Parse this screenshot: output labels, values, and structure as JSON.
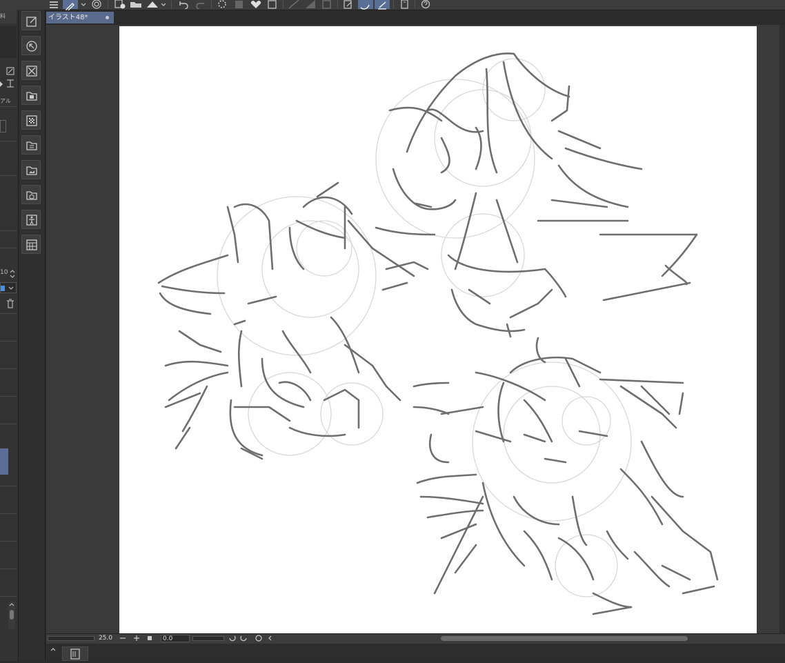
{
  "document": {
    "tab_title": "イラスト48*"
  },
  "left_panel": {
    "text_top": "料",
    "text_mid": "アル",
    "number": "10"
  },
  "bottom_bar": {
    "zoom_value": "25.0",
    "rotation_value": "0.0"
  },
  "icons": {
    "toolbar": [
      "menu-icon",
      "pen-settings-icon",
      "chevron-down-icon",
      "spiral-icon",
      "new-icon",
      "open-folder-icon",
      "save-icon",
      "undo-icon",
      "redo-icon",
      "loading-icon",
      "fill-icon",
      "heart-icon",
      "crop-icon",
      "slash-icon",
      "gradient-icon",
      "frame-icon",
      "edit-icon",
      "stabilizer-icon",
      "transform-icon",
      "phone-icon",
      "help-icon"
    ],
    "column": [
      "canvas-properties-icon",
      "select-arrow-icon",
      "deselect-icon",
      "layer-folder-icon",
      "transparency-icon",
      "layer-color-icon",
      "layer-image-icon",
      "layer-3d-icon",
      "layer-pose-icon",
      "layer-grid-icon"
    ]
  },
  "colors": {
    "tab_active": "#5a6a8c",
    "toolbar_active": "#5a6f96",
    "canvas": "#ffffff",
    "sketch_stroke": "#707070",
    "guide_stroke": "#d6d6d6"
  }
}
